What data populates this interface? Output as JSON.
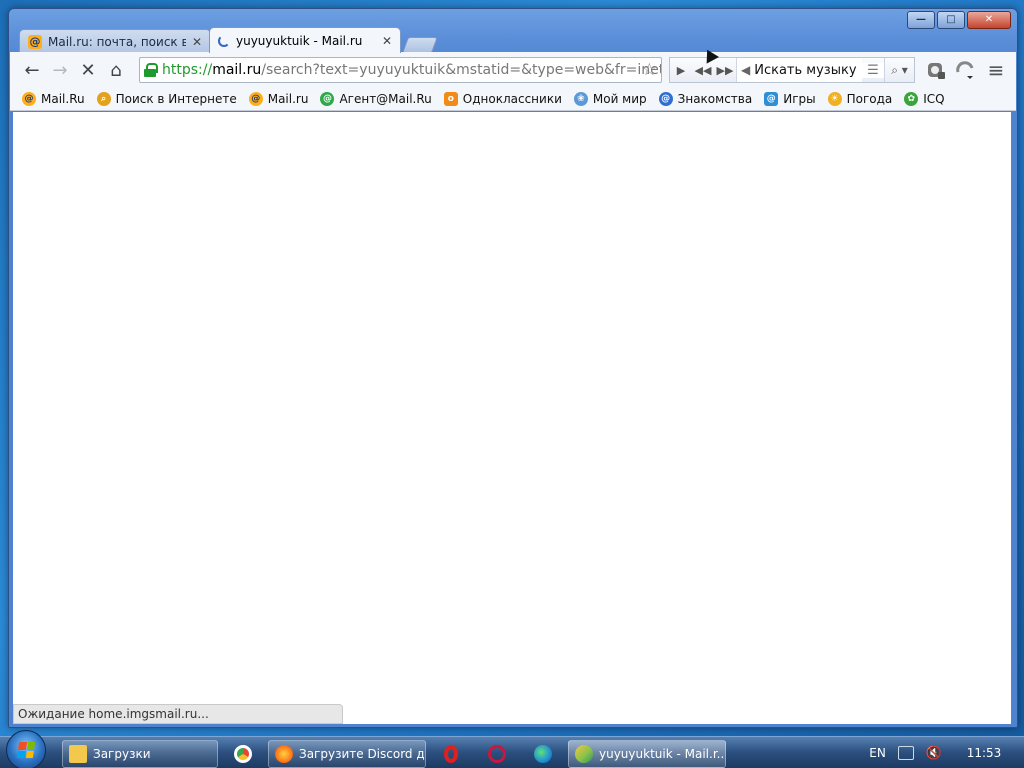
{
  "window": {
    "controls": {
      "minimize": "—",
      "maximize": "□",
      "close": "✕"
    }
  },
  "tabs": [
    {
      "title": "Mail.ru: почта, поиск в и",
      "active": false,
      "icon": "mailru-icon"
    },
    {
      "title": "yuyuyuktuik - Mail.ru",
      "active": true,
      "icon": "loading-spinner-icon"
    }
  ],
  "toolbar": {
    "back": "←",
    "forward": "→",
    "stop": "✕",
    "home": "⌂",
    "url": {
      "scheme": "https://",
      "host": "mail.ru",
      "rest": "/search?text=yuyuyuktuik&mstatid=&type=web&fr=inete"
    },
    "star": "☆",
    "music": {
      "play": "▶",
      "prev": "◀◀",
      "next": "▶▶",
      "speaker": "◀",
      "placeholder": "Искать музыку",
      "menu": "☰",
      "search": "⌕ ▾"
    },
    "ext_icons": [
      "agent-icon",
      "weather-icon",
      "menu-icon"
    ],
    "menu_glyph": "≡"
  },
  "bookmarks": [
    {
      "label": "Mail.Ru",
      "icon": "mailru-icon",
      "color": "#ffae1a",
      "glyph": "@"
    },
    {
      "label": "Поиск в Интернете",
      "icon": "search-icon",
      "color": "#e4a11b",
      "glyph": "⌕"
    },
    {
      "label": "Mail.ru",
      "icon": "mailru-icon",
      "color": "#ffae1a",
      "glyph": "@"
    },
    {
      "label": "Агент@Mail.Ru",
      "icon": "agent-icon",
      "color": "#2da84a",
      "glyph": "@"
    },
    {
      "label": "Одноклассники",
      "icon": "odnoklassniki-icon",
      "color": "#f08a18",
      "glyph": "о"
    },
    {
      "label": "Мой мир",
      "icon": "my-world-icon",
      "color": "#5a9ad6",
      "glyph": "❀"
    },
    {
      "label": "Знакомства",
      "icon": "dating-icon",
      "color": "#2f6fd0",
      "glyph": "@"
    },
    {
      "label": "Игры",
      "icon": "games-icon",
      "color": "#2f8fd6",
      "glyph": "@"
    },
    {
      "label": "Погода",
      "icon": "weather-icon",
      "color": "#f0b020",
      "glyph": "☀"
    },
    {
      "label": "ICQ",
      "icon": "icq-icon",
      "color": "#3aa53a",
      "glyph": "✿"
    }
  ],
  "status": "Ожидание home.imgsmail.ru...",
  "taskbar": {
    "items": [
      {
        "label": "Загрузки",
        "icon": "folder-icon",
        "color": "#f2c94c"
      },
      {
        "label": "",
        "icon": "chrome-icon",
        "color": "#e8453c"
      },
      {
        "label": "Загрузите Discord д...",
        "icon": "firefox-icon",
        "color": "#ff7a1a"
      },
      {
        "label": "",
        "icon": "opera-icon",
        "color": "#e0201e"
      },
      {
        "label": "",
        "icon": "opera-gx-icon",
        "color": "#c9183e"
      },
      {
        "label": "",
        "icon": "edge-icon",
        "color": "#1f8fd6"
      },
      {
        "label": "yuyuyuktuik - Mail.r...",
        "icon": "amigo-icon",
        "color": "#8bc34a",
        "active": true
      }
    ],
    "lang": "EN",
    "time": "11:53"
  }
}
